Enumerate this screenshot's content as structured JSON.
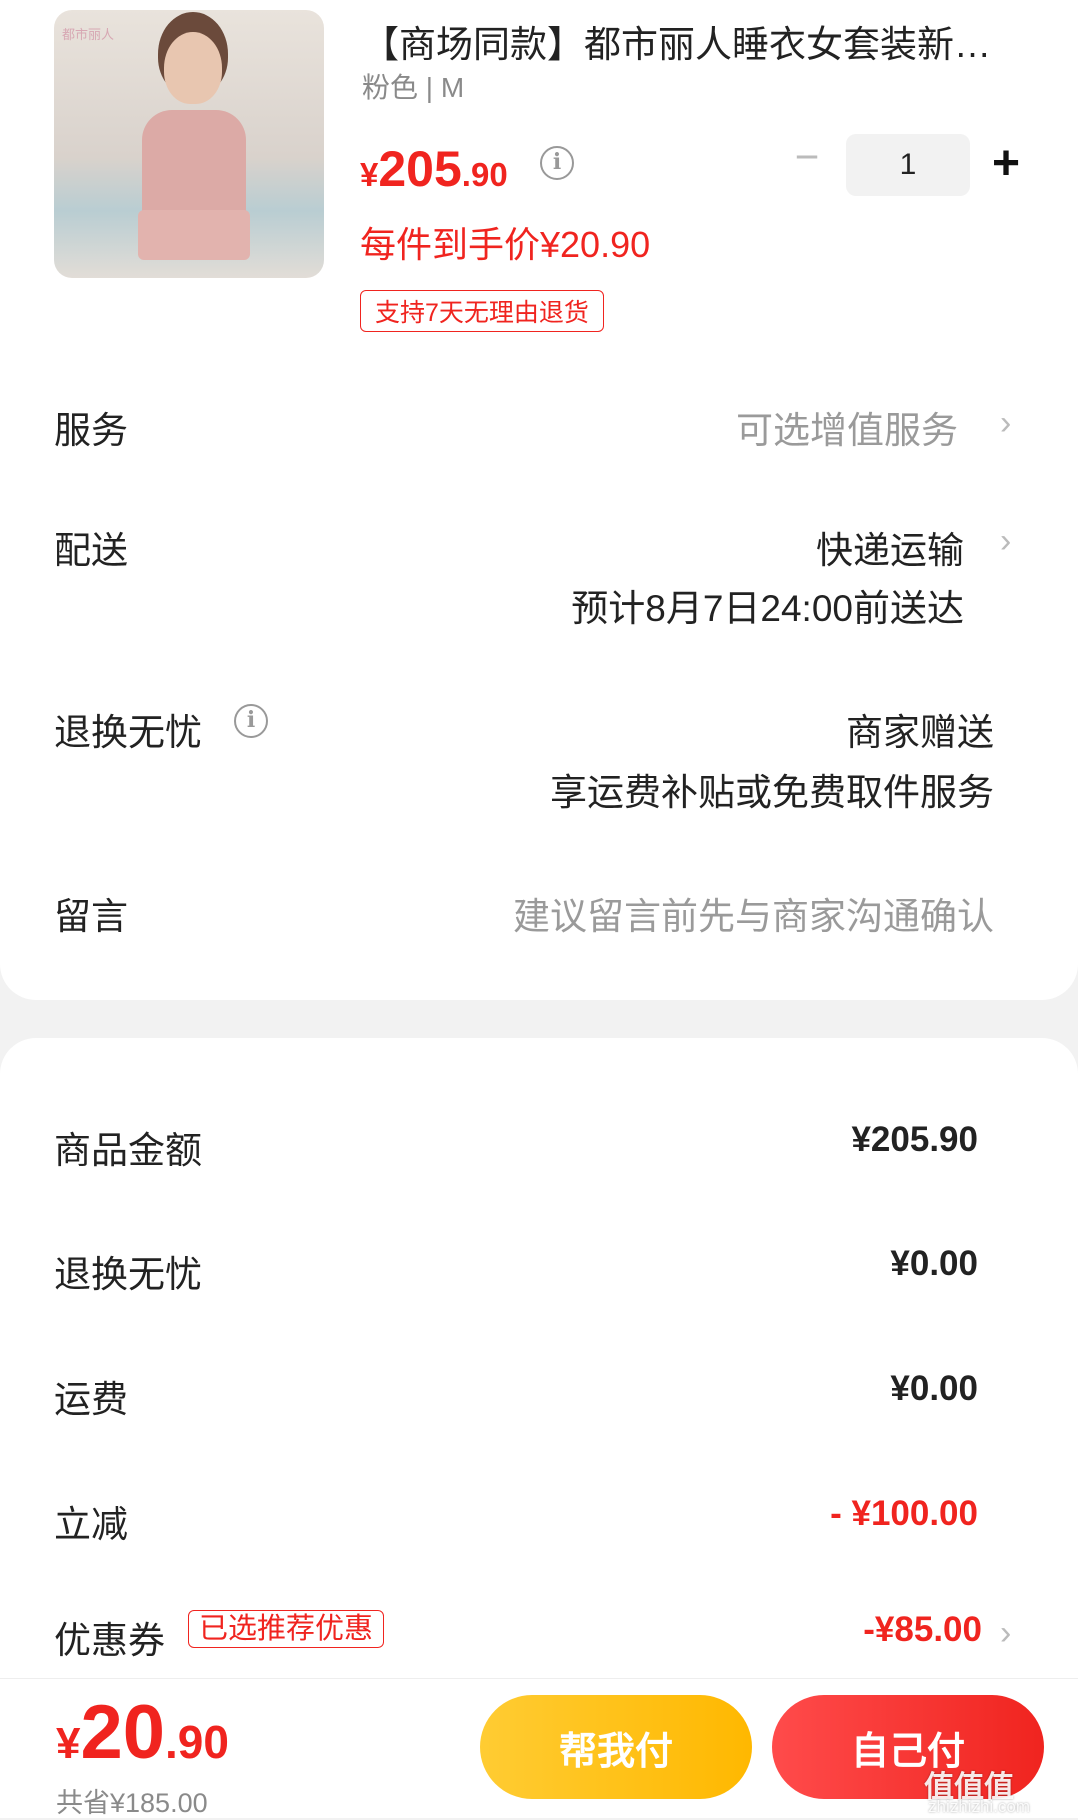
{
  "product": {
    "image_logo": "都市丽人",
    "title": "【商场同款】都市丽人睡衣女套装新…",
    "sku": "粉色 | M",
    "price_yen": "¥",
    "price_int": "205",
    "price_dec": ".90",
    "unit_price": "每件到手价¥20.90",
    "return_tag": "支持7天无理由退货",
    "quantity": "1",
    "minus": "−",
    "plus": "+",
    "info_icon": "info-icon"
  },
  "service": {
    "label": "服务",
    "value": "可选增值服务"
  },
  "delivery": {
    "label": "配送",
    "method": "快递运输",
    "eta": "预计8月7日24:00前送达"
  },
  "worry_free": {
    "label": "退换无忧",
    "value": "商家赠送",
    "desc": "享运费补贴或免费取件服务"
  },
  "message": {
    "label": "留言",
    "placeholder": "建议留言前先与商家沟通确认"
  },
  "summary": {
    "goods_label": "商品金额",
    "goods_value": "¥205.90",
    "worry_label": "退换无忧",
    "worry_value": "¥0.00",
    "shipping_label": "运费",
    "shipping_value": "¥0.00",
    "discount_label": "立减",
    "discount_value": "- ¥100.00",
    "coupon_label": "优惠券",
    "coupon_tag": "已选推荐优惠",
    "coupon_value": "-¥85.00"
  },
  "bottom": {
    "total_yen": "¥",
    "total_int": "20",
    "total_dec": ".90",
    "saved": "共省¥185.00",
    "help_pay": "帮我付",
    "self_pay": "自己付"
  },
  "watermark": {
    "text": "值值值",
    "url": "zhizhizhi.com"
  },
  "chevron": "›",
  "colors": {
    "accent_red": "#f0241f",
    "help_yellow": "#ffb800"
  }
}
